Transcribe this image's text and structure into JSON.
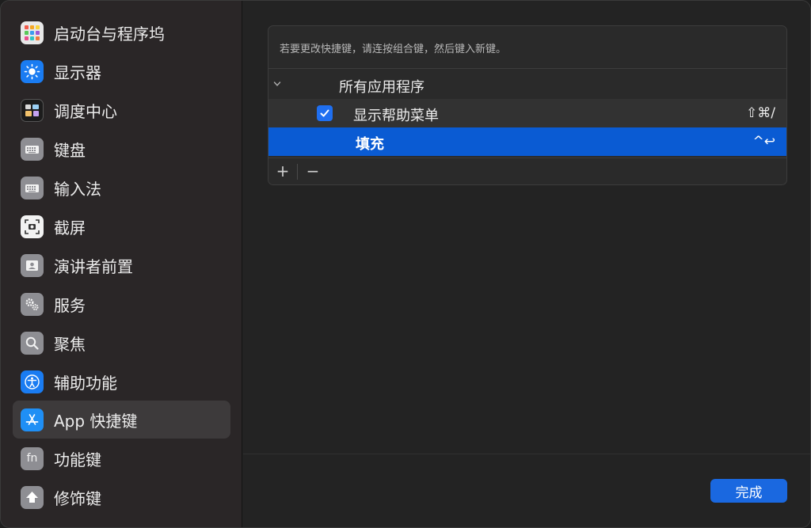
{
  "sidebar": {
    "items": [
      {
        "label": "启动台与程序坞",
        "icon": "launchpad-dock-icon"
      },
      {
        "label": "显示器",
        "icon": "display-sun-icon"
      },
      {
        "label": "调度中心",
        "icon": "mission-control-icon"
      },
      {
        "label": "键盘",
        "icon": "keyboard-icon"
      },
      {
        "label": "输入法",
        "icon": "input-method-icon"
      },
      {
        "label": "截屏",
        "icon": "screenshot-icon"
      },
      {
        "label": "演讲者前置",
        "icon": "presenter-overlay-icon"
      },
      {
        "label": "服务",
        "icon": "services-gear-icon"
      },
      {
        "label": "聚焦",
        "icon": "spotlight-search-icon"
      },
      {
        "label": "辅助功能",
        "icon": "accessibility-icon"
      },
      {
        "label": "App 快捷键",
        "icon": "app-store-icon"
      },
      {
        "label": "功能键",
        "icon": "fn-key-icon"
      },
      {
        "label": "修饰键",
        "icon": "modifier-key-icon"
      }
    ],
    "selected_index": 10
  },
  "main": {
    "instruction": "若要更改快捷键，请连按组合键，然后键入新键。",
    "group_label": "所有应用程序",
    "rows": [
      {
        "label": "显示帮助菜单",
        "shortcut": "⇧⌘/",
        "checked": true
      },
      {
        "label": "填充",
        "shortcut": "^↩",
        "checked": null
      }
    ],
    "add_label": "+",
    "remove_label": "−",
    "done_label": "完成"
  },
  "colors": {
    "accent": "#0a5bd3",
    "button": "#1a68e0"
  }
}
